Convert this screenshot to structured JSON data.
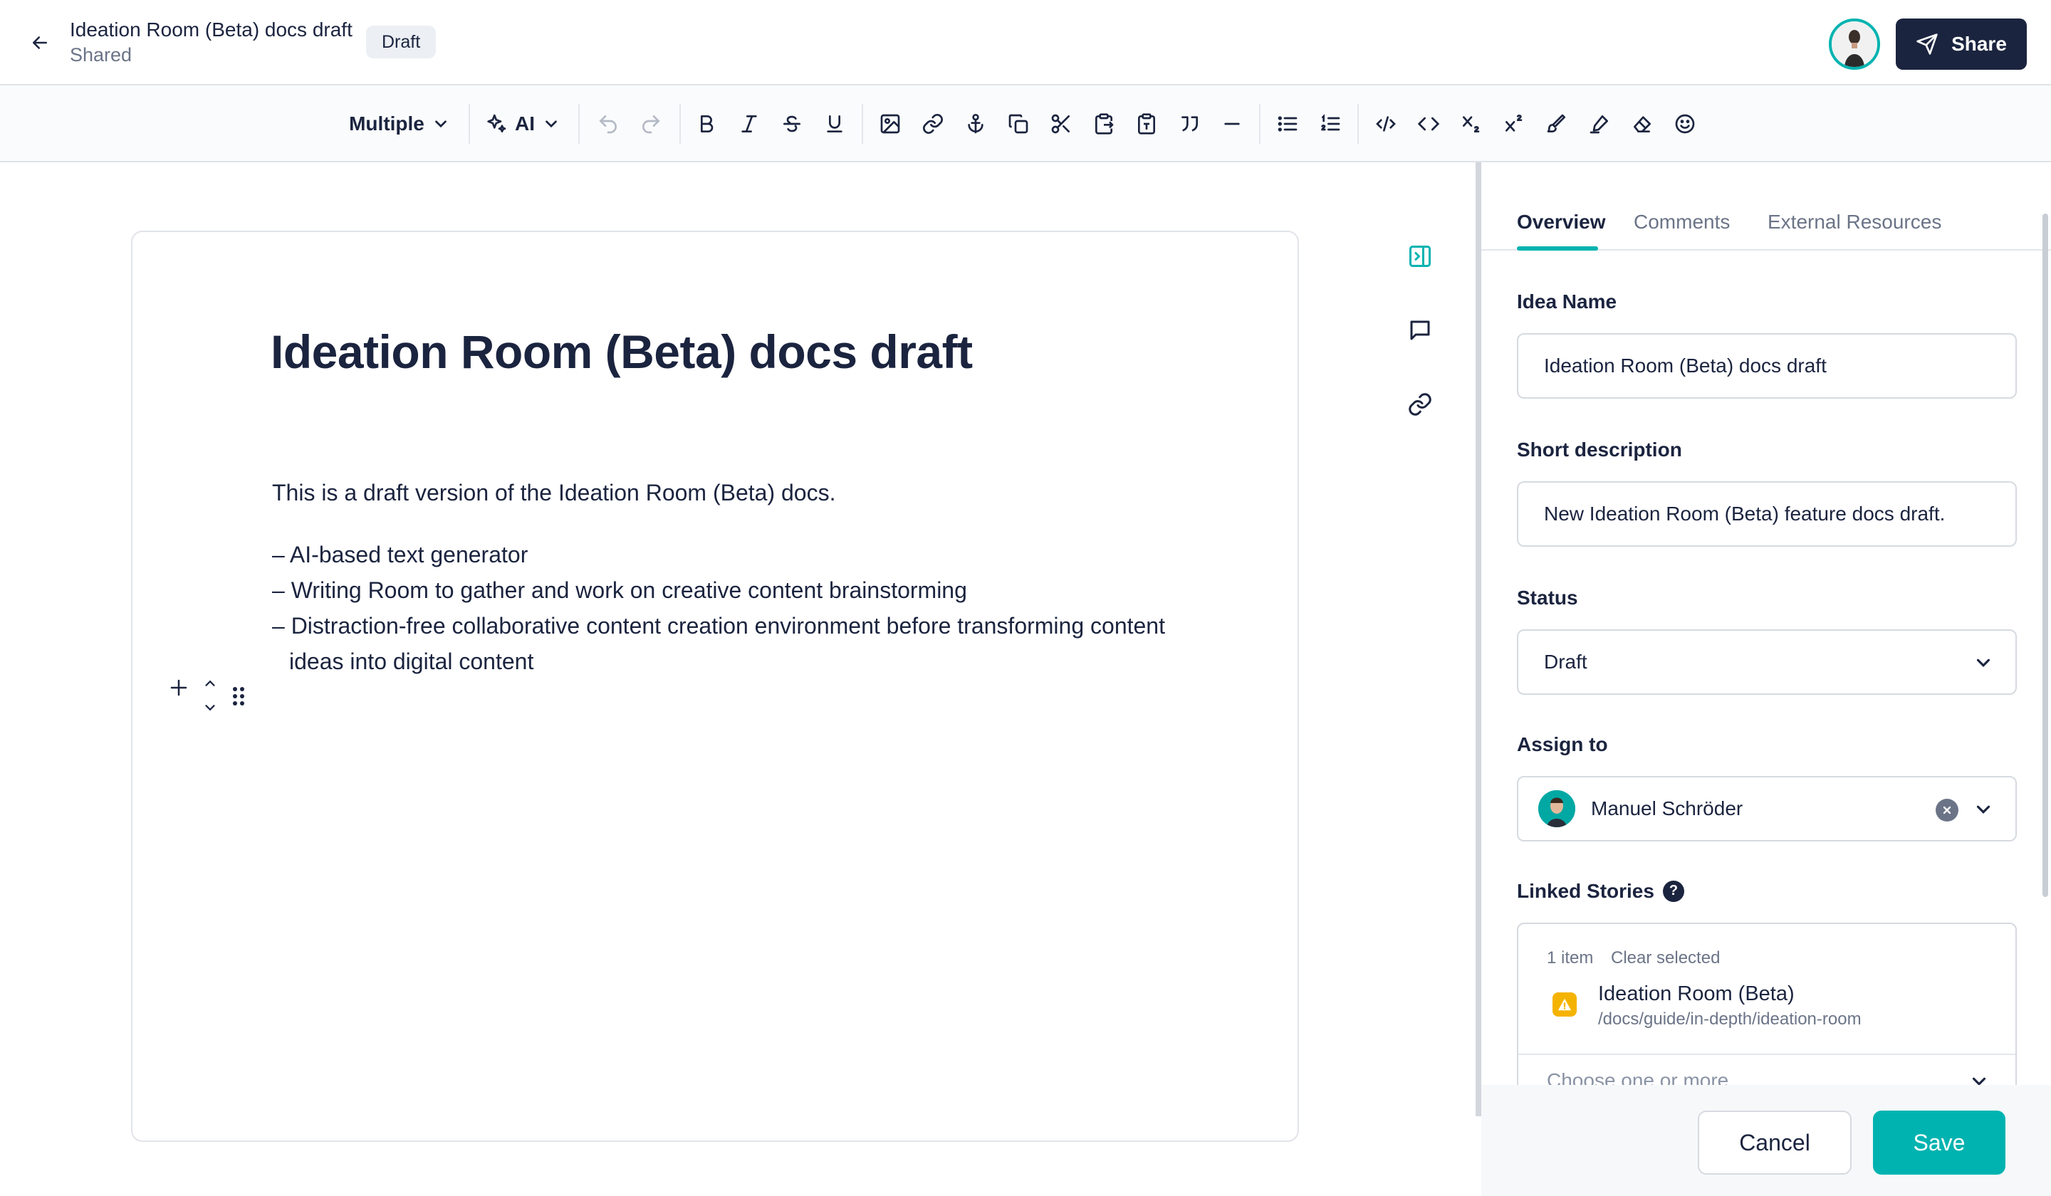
{
  "header": {
    "title": "Ideation Room (Beta) docs draft",
    "subtitle": "Shared",
    "badge": "Draft",
    "share_label": "Share"
  },
  "toolbar": {
    "format_select": "Multiple",
    "ai_label": "AI",
    "buttons": [
      "undo",
      "redo",
      "bold",
      "italic",
      "strikethrough",
      "underline",
      "image",
      "link",
      "anchor",
      "copy",
      "cut",
      "paste-special",
      "paste",
      "quote",
      "horizontal-rule",
      "bullet-list",
      "ordered-list",
      "code-block",
      "inline-code",
      "subscript",
      "superscript",
      "highlight-pen",
      "color-marker",
      "clear-format",
      "emoji"
    ]
  },
  "document": {
    "title": "Ideation Room (Beta) docs draft",
    "paragraph": "This is a draft version of the Ideation Room (Beta) docs.",
    "list": [
      "– AI-based text generator",
      "– Writing Room to gather and work on creative content brainstorming",
      "– Distraction-free collaborative content creation environment before transforming content ideas into digital content"
    ]
  },
  "panel": {
    "tabs": [
      "Overview",
      "Comments",
      "External Resources"
    ],
    "active_tab": "Overview",
    "idea_name_label": "Idea Name",
    "idea_name_value": "Ideation Room (Beta) docs draft",
    "short_desc_label": "Short description",
    "short_desc_value": "New Ideation Room (Beta) feature docs draft.",
    "status_label": "Status",
    "status_value": "Draft",
    "assign_label": "Assign to",
    "assign_value": "Manuel Schröder",
    "linked_label": "Linked Stories",
    "linked_count": "1 item",
    "clear_selected": "Clear selected",
    "story_title": "Ideation Room (Beta)",
    "story_path": "/docs/guide/in-depth/ideation-room",
    "choose_placeholder": "Choose one or more",
    "cancel_label": "Cancel",
    "save_label": "Save"
  },
  "colors": {
    "accent": "#00b3b0",
    "navy": "#1b243f",
    "muted": "#6b7487",
    "warning": "#f5b301"
  }
}
